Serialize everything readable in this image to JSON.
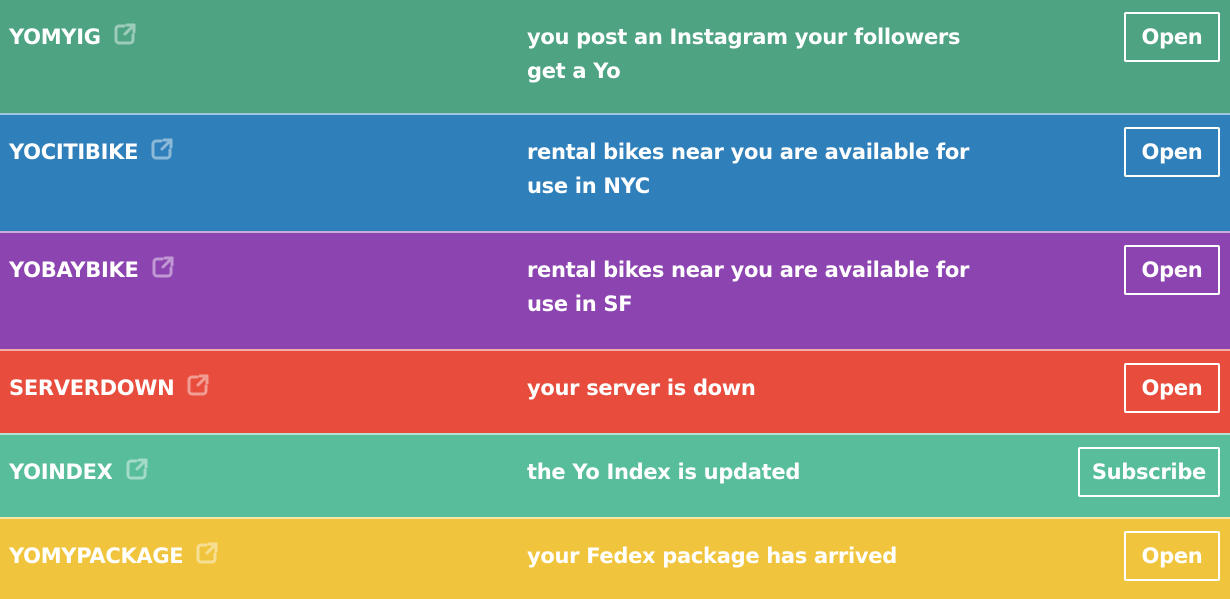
{
  "rows": [
    {
      "name": "YOMYIG",
      "description": "you post an Instagram your followers get a Yo",
      "button": "Open",
      "color": "#4ea383",
      "icon": "external-link-icon"
    },
    {
      "name": "YOCITIBIKE",
      "description": "rental bikes near you are available for use in NYC",
      "button": "Open",
      "color": "#2f7fbb",
      "icon": "external-link-icon"
    },
    {
      "name": "YOBAYBIKE",
      "description": "rental bikes near you are available for use in SF",
      "button": "Open",
      "color": "#8c44b0",
      "icon": "external-link-icon"
    },
    {
      "name": "SERVERDOWN",
      "description": "your server is down",
      "button": "Open",
      "color": "#e74c3c",
      "icon": "external-link-icon"
    },
    {
      "name": "YOINDEX",
      "description": "the Yo Index is updated",
      "button": "Subscribe",
      "color": "#57bd9b",
      "icon": "external-link-icon"
    },
    {
      "name": "YOMYPACKAGE",
      "description": "your Fedex package has arrived",
      "button": "Open",
      "color": "#f0c53d",
      "icon": "external-link-icon"
    }
  ]
}
